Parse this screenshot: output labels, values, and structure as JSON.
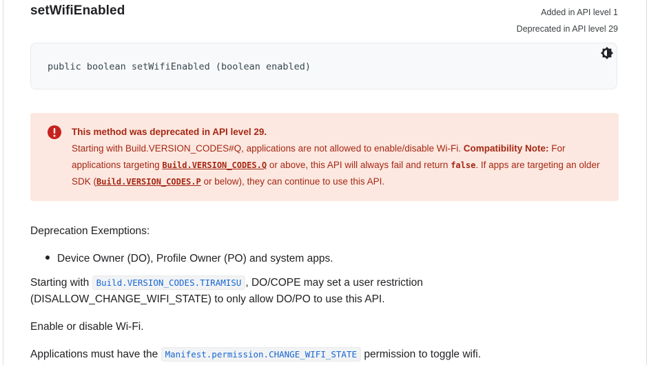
{
  "method": {
    "title": "setWifiEnabled",
    "added": "Added in API level 1",
    "deprecated": "Deprecated in API level 29",
    "signature": "public boolean setWifiEnabled (boolean enabled)"
  },
  "icons": {
    "theme_toggle": "brightness-contrast-icon",
    "caution": "exclamation-circle-icon"
  },
  "colors": {
    "caution_bg": "#fce8e0",
    "caution_text": "#a52714",
    "code_link": "#1967d2"
  },
  "caution": {
    "heading": "This method was deprecated in API level 29.",
    "t1": "Starting with Build.VERSION_CODES#Q, applications are not allowed to enable/disable Wi-Fi. ",
    "compat_label": "Compatibility Note:",
    "t2": " For applications targeting ",
    "link1": "Build.VERSION_CODES.Q",
    "t3": " or above, this API will always fail and return ",
    "code_false": "false",
    "t4": ". If apps are targeting an older SDK (",
    "link2": "Build.VERSION_CODES.P",
    "t5": " or below), they can continue to use this API."
  },
  "body": {
    "exemptions_label": "Deprecation Exemptions:",
    "exemption_items": [
      "Device Owner (DO), Profile Owner (PO) and system apps."
    ],
    "starting_with": "Starting with ",
    "tiramisu_link": "Build.VERSION_CODES.TIRAMISU",
    "tiramisu_rest": ", DO/COPE may set a user restriction (DISALLOW_CHANGE_WIFI_STATE) to only allow DO/PO to use this API.",
    "enable_disable": "Enable or disable Wi-Fi.",
    "apps_must": "Applications must have the ",
    "permission_link": "Manifest.permission.CHANGE_WIFI_STATE",
    "apps_rest": " permission to toggle wifi."
  }
}
